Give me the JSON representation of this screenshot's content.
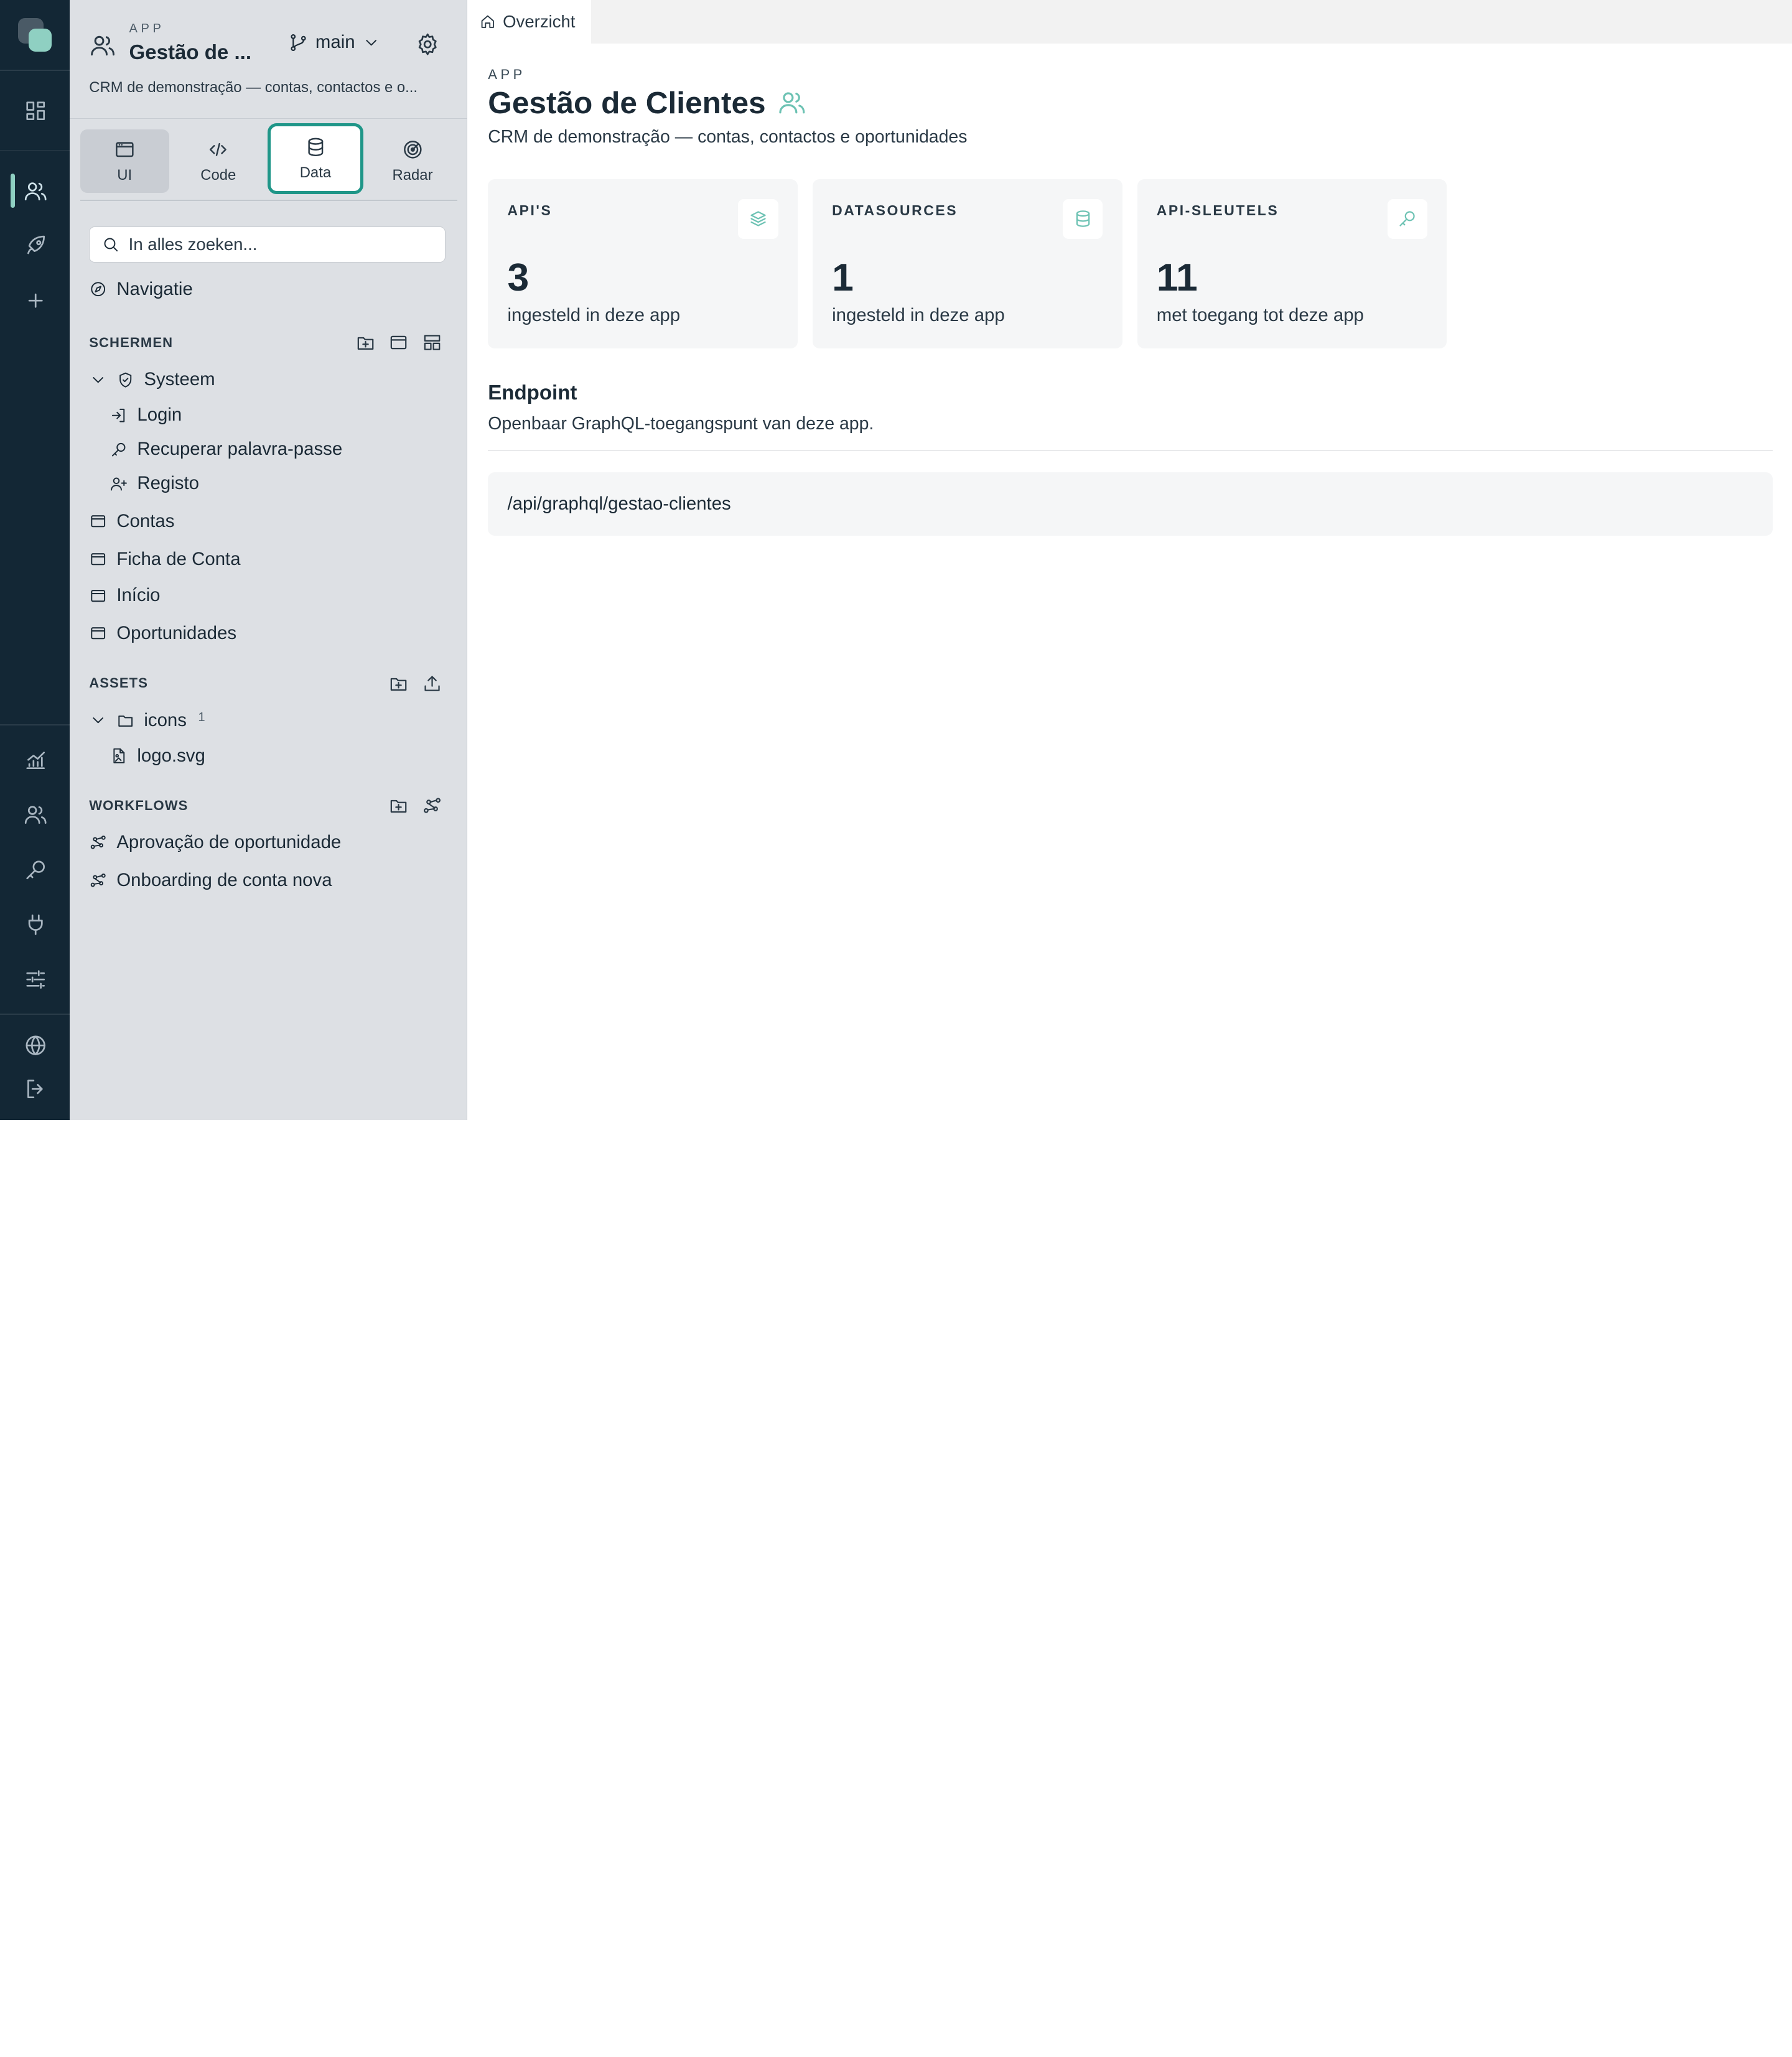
{
  "rail": {
    "icons": [
      "dashboard-icon",
      "users-icon",
      "rocket-icon",
      "plus-icon",
      "chart-icon",
      "team-icon",
      "key-icon",
      "plug-icon",
      "sliders-icon",
      "globe-icon",
      "logout-icon"
    ]
  },
  "sidebar": {
    "kicker": "APP",
    "title": "Gestão de ...",
    "branch": "main",
    "description": "CRM de demonstração — contas, contactos e o...",
    "tabs": {
      "ui": "UI",
      "code": "Code",
      "data": "Data",
      "radar": "Radar"
    },
    "search_placeholder": "In alles zoeken...",
    "navigation": "Navigatie",
    "screens": {
      "header": "SCHERMEN",
      "system": "Systeem",
      "login": "Login",
      "recover": "Recuperar palavra-passe",
      "register": "Registo",
      "accounts": "Contas",
      "account_sheet": "Ficha de Conta",
      "home": "Início",
      "opportunities": "Oportunidades"
    },
    "assets": {
      "header": "ASSETS",
      "folder": "icons",
      "folder_count": "1",
      "file": "logo.svg"
    },
    "workflows": {
      "header": "WORKFLOWS",
      "items": [
        "Aprovação de oportunidade",
        "Onboarding de conta nova"
      ]
    }
  },
  "main": {
    "tab": "Overzicht",
    "kicker": "APP",
    "title": "Gestão de Clientes",
    "description": "CRM de demonstração — contas, contactos e oportunidades",
    "cards": [
      {
        "label": "API'S",
        "value": "3",
        "sub": "ingesteld in deze app",
        "icon": "layers-icon"
      },
      {
        "label": "DATASOURCES",
        "value": "1",
        "sub": "ingesteld in deze app",
        "icon": "database-icon"
      },
      {
        "label": "API-SLEUTELS",
        "value": "11",
        "sub": "met toegang tot deze app",
        "icon": "key-icon"
      }
    ],
    "endpoint": {
      "title": "Endpoint",
      "description": "Openbaar GraphQL-toegangspunt van deze app.",
      "url": "/api/graphql/gestao-clientes"
    }
  },
  "colors": {
    "rail": "#132735",
    "sidebar": "#dde0e4",
    "accent": "#1f9688",
    "icon_accent": "#6cc2b3"
  }
}
